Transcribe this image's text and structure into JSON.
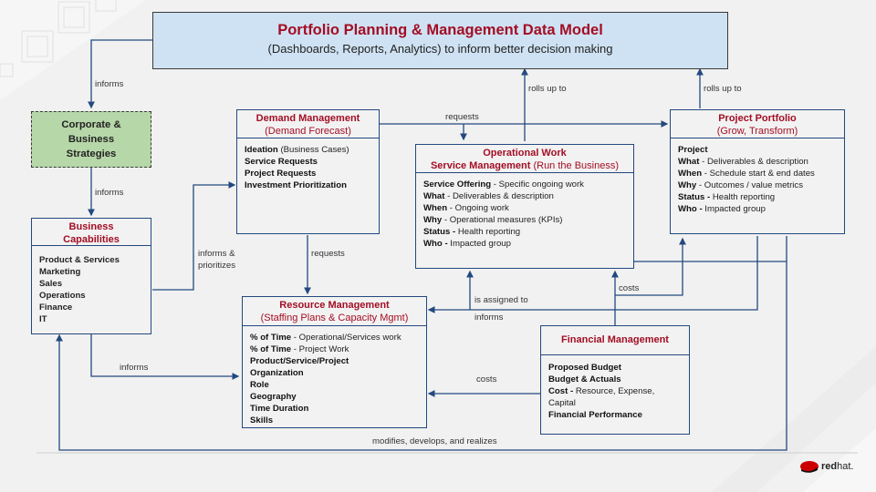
{
  "title": {
    "heading": "Portfolio Planning & Management Data Model",
    "subheading": "(Dashboards, Reports, Analytics) to inform better decision making"
  },
  "corporate": {
    "label": "Corporate & Business Strategies",
    "fill_color": "#b6d7a8"
  },
  "capabilities": {
    "title": "Business Capabilities",
    "items": [
      "Product & Services",
      "Marketing",
      "Sales",
      "Operations",
      "Finance",
      "IT"
    ]
  },
  "demand": {
    "title": "Demand Management",
    "subtitle": "(Demand Forecast)",
    "items": [
      {
        "bold": "Ideation",
        "rest": " (Business Cases)"
      },
      {
        "bold": "Service Requests",
        "rest": ""
      },
      {
        "bold": "Project Requests",
        "rest": ""
      },
      {
        "bold": "Investment Prioritization",
        "rest": ""
      }
    ]
  },
  "operational": {
    "title": "Operational Work",
    "title2_bold": "Service Management",
    "title2_rest": " (Run the Business)",
    "items": [
      {
        "bold": "Service Offering",
        "rest": " - Specific ongoing work"
      },
      {
        "bold": "What",
        "rest": " - Deliverables & description"
      },
      {
        "bold": "When",
        "rest": " - Ongoing work"
      },
      {
        "bold": "Why",
        "rest": " - Operational measures (KPIs)"
      },
      {
        "bold": "Status -",
        "rest": " Health reporting"
      },
      {
        "bold": "Who -",
        "rest": " Impacted group"
      }
    ]
  },
  "project": {
    "title": "Project Portfolio",
    "subtitle": "(Grow, Transform)",
    "items": [
      {
        "bold": "Project",
        "rest": ""
      },
      {
        "bold": "What",
        "rest": " - Deliverables & description"
      },
      {
        "bold": "When",
        "rest": " - Schedule start & end dates"
      },
      {
        "bold": "Why",
        "rest": " - Outcomes / value metrics"
      },
      {
        "bold": "Status -",
        "rest": " Health reporting"
      },
      {
        "bold": "Who -",
        "rest": " Impacted group"
      }
    ]
  },
  "resource": {
    "title": "Resource Management",
    "subtitle": "(Staffing Plans & Capacity Mgmt)",
    "items": [
      {
        "bold": "% of Time",
        "rest": " - Operational/Services work"
      },
      {
        "bold": "% of Time",
        "rest": " - Project Work"
      },
      {
        "bold": "Product/Service/Project",
        "rest": ""
      },
      {
        "bold": "Organization",
        "rest": ""
      },
      {
        "bold": "Role",
        "rest": ""
      },
      {
        "bold": "Geography",
        "rest": ""
      },
      {
        "bold": "Time Duration",
        "rest": ""
      },
      {
        "bold": "Skills",
        "rest": ""
      }
    ]
  },
  "financial": {
    "title": "Financial Management",
    "items": [
      {
        "bold": "Proposed Budget",
        "rest": ""
      },
      {
        "bold": "Budget & Actuals",
        "rest": ""
      },
      {
        "bold": "Cost -",
        "rest": " Resource, Expense, Capital"
      },
      {
        "bold": "Financial Performance",
        "rest": ""
      }
    ]
  },
  "labels": {
    "informs_top": "informs",
    "informs_corp": "informs",
    "informs_prioritizes": "informs & prioritizes",
    "requests_demand_resource": "requests",
    "requests_top": "requests",
    "rolls_up_1": "rolls up to",
    "rolls_up_2": "rolls up to",
    "is_assigned_to": "is assigned to",
    "informs_resource": "informs",
    "costs_project": "costs",
    "costs_resource": "costs",
    "informs_cap_resource": "informs",
    "modifies": "modifies, develops, and realizes"
  },
  "logo": {
    "brand_bold": "red",
    "brand_rest": "hat."
  },
  "colors": {
    "line": "#23497f",
    "heading_red": "#a30e24",
    "title_fill": "#cfe2f3"
  }
}
